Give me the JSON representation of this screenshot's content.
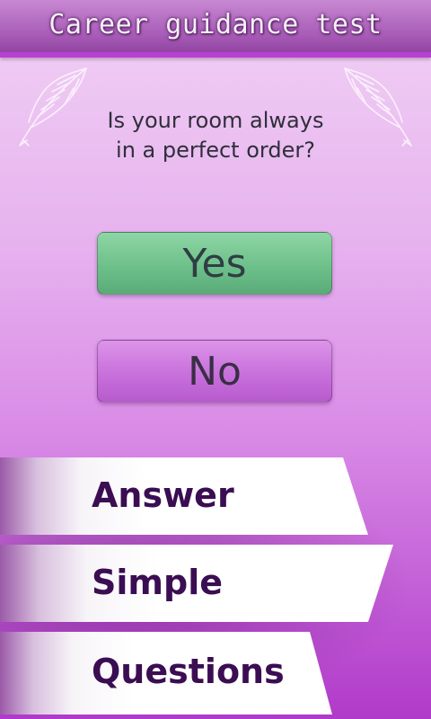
{
  "header": {
    "title": "Career guidance test"
  },
  "decor": {
    "left_icon": "feather-quill-icon",
    "right_icon": "feather-quill-icon"
  },
  "question": {
    "line1": "Is your room always",
    "line2": "in a perfect order?"
  },
  "answers": {
    "yes_label": "Yes",
    "no_label": "No"
  },
  "banner": {
    "words": [
      "Answer",
      "Simple",
      "Questions"
    ]
  },
  "colors": {
    "header": "#a85db7",
    "yes": "#6ec08b",
    "no": "#c870dc",
    "banner_text": "#3b0d52"
  }
}
